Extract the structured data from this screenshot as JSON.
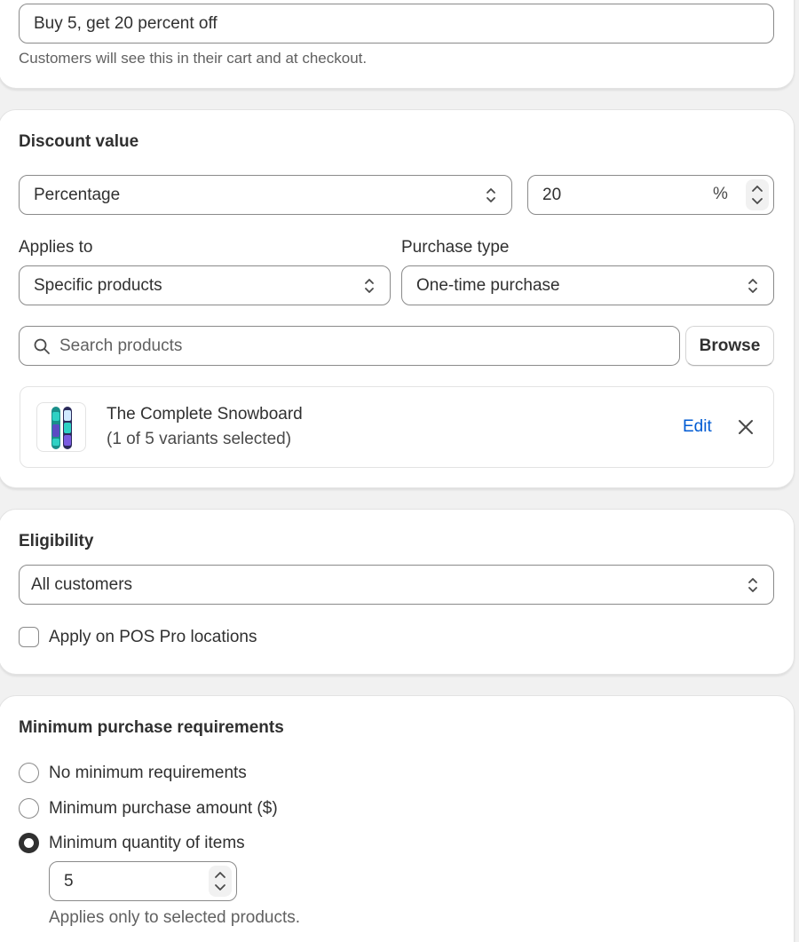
{
  "title_section": {
    "title_value": "Buy 5, get 20 percent off",
    "help_text": "Customers will see this in their cart and at checkout."
  },
  "discount_value": {
    "heading": "Discount value",
    "type_selected": "Percentage",
    "amount_value": "20",
    "amount_suffix": "%",
    "applies_to_label": "Applies to",
    "applies_to_selected": "Specific products",
    "purchase_type_label": "Purchase type",
    "purchase_type_selected": "One-time purchase",
    "search_placeholder": "Search products",
    "browse_label": "Browse",
    "product": {
      "name": "The Complete Snowboard",
      "variants": "(1 of 5 variants selected)",
      "edit_label": "Edit"
    }
  },
  "eligibility": {
    "heading": "Eligibility",
    "selected": "All customers",
    "pos_label": "Apply on POS Pro locations",
    "pos_checked": false
  },
  "minimum_requirements": {
    "heading": "Minimum purchase requirements",
    "options": [
      {
        "label": "No minimum requirements",
        "checked": false
      },
      {
        "label": "Minimum purchase amount ($)",
        "checked": false
      },
      {
        "label": "Minimum quantity of items",
        "checked": true
      }
    ],
    "quantity_value": "5",
    "help_text": "Applies only to selected products."
  },
  "colors": {
    "link": "#005bd3",
    "text": "#303030",
    "subdued": "#616161",
    "border": "#8a8a8a",
    "background": "#f1f1f1"
  },
  "icons": {
    "select": "chevron-up-down-icon",
    "stepper": "stepper-arrows-icon",
    "search": "search-icon",
    "remove": "close-icon"
  }
}
